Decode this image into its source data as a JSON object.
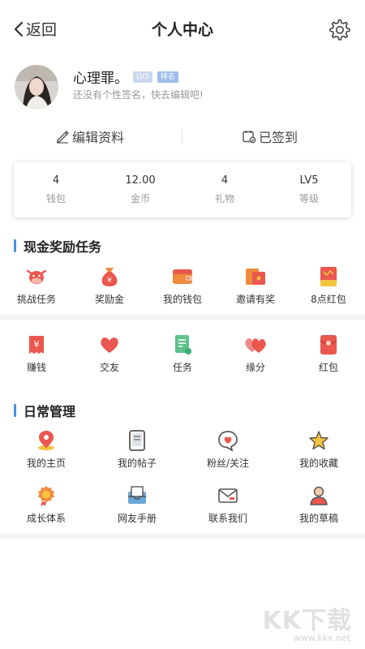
{
  "header": {
    "back_label": "返回",
    "title": "个人中心"
  },
  "profile": {
    "name": "心理罪。",
    "level_badge": "LV5",
    "tag_badge": "排名",
    "signature": "还没有个性签名，快去编辑吧!"
  },
  "actions": {
    "edit_label": "编辑资料",
    "signin_label": "已签到"
  },
  "stats": [
    {
      "value": "4",
      "label": "钱包"
    },
    {
      "value": "12.00",
      "label": "金币"
    },
    {
      "value": "4",
      "label": "礼物"
    },
    {
      "value": "LV5",
      "label": "等级"
    }
  ],
  "cash_tasks": {
    "title": "现金奖励任务",
    "row1": [
      {
        "label": "挑战任务",
        "icon": "cow-icon"
      },
      {
        "label": "奖励金",
        "icon": "money-bag-icon"
      },
      {
        "label": "我的钱包",
        "icon": "wallet-icon"
      },
      {
        "label": "邀请有奖",
        "icon": "envelope-icon"
      },
      {
        "label": "8点红包",
        "icon": "red-packet-8-icon"
      }
    ],
    "row2": [
      {
        "label": "赚钱",
        "icon": "yuan-receipt-icon"
      },
      {
        "label": "交友",
        "icon": "heart-icon"
      },
      {
        "label": "任务",
        "icon": "task-doc-icon"
      },
      {
        "label": "缘分",
        "icon": "double-heart-icon"
      },
      {
        "label": "红包",
        "icon": "red-envelope-icon"
      }
    ]
  },
  "daily": {
    "title": "日常管理",
    "row1": [
      {
        "label": "我的主页",
        "icon": "location-pin-icon"
      },
      {
        "label": "我的帖子",
        "icon": "tablet-icon"
      },
      {
        "label": "粉丝/关注",
        "icon": "heart-bubble-icon"
      },
      {
        "label": "我的收藏",
        "icon": "star-icon"
      }
    ],
    "row2": [
      {
        "label": "成长体系",
        "icon": "medal-icon"
      },
      {
        "label": "网友手册",
        "icon": "inbox-icon"
      },
      {
        "label": "联系我们",
        "icon": "mail-icon"
      },
      {
        "label": "我的草稿",
        "icon": "user-icon"
      }
    ]
  },
  "watermark": {
    "text": "KK下载",
    "url": "www.kkx.net"
  },
  "colors": {
    "accent": "#4a90e2",
    "red": "#e9574f",
    "orange": "#f08a3c",
    "green": "#5cc28a",
    "gold": "#f3c33d"
  }
}
